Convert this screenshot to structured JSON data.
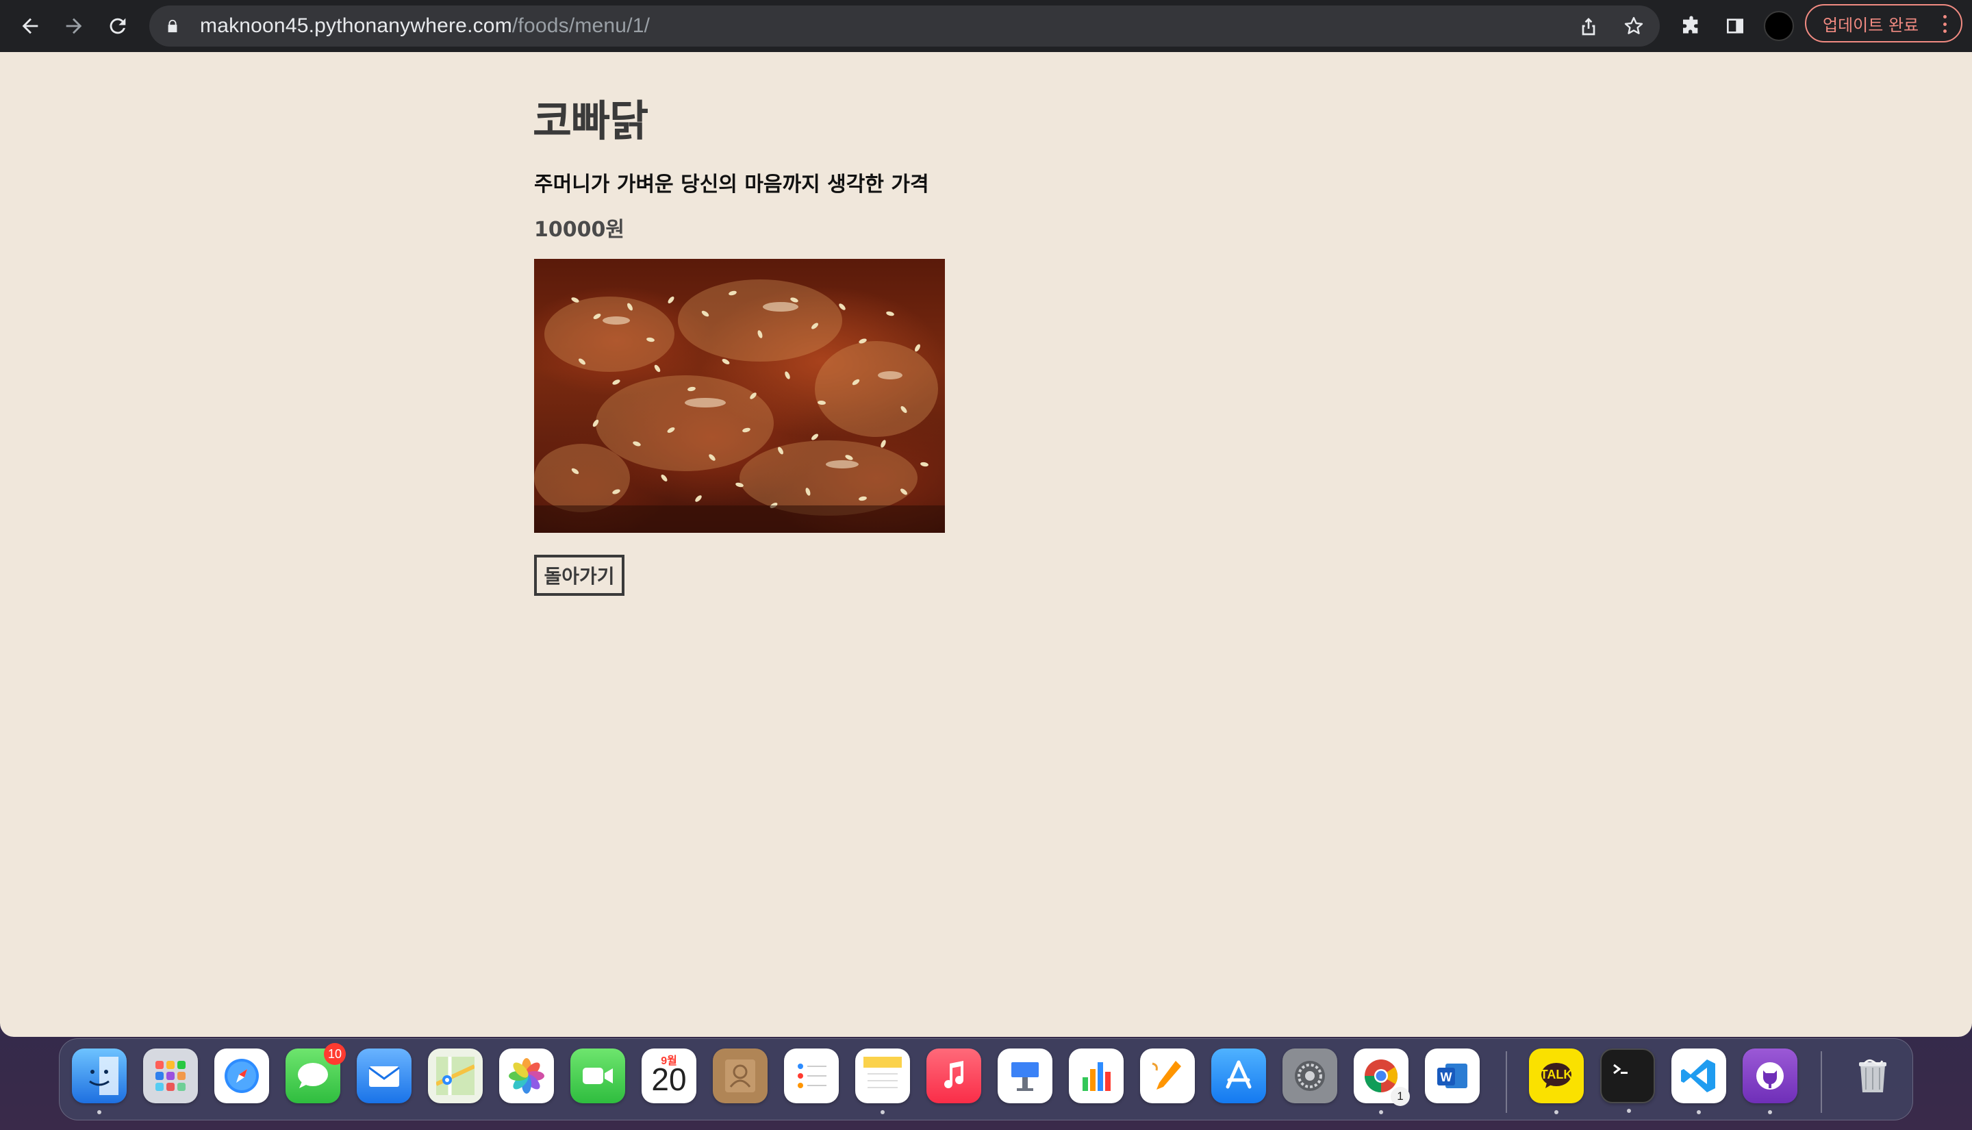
{
  "browser": {
    "url_host": "maknoon45.pythonanywhere.com",
    "url_path": "/foods/menu/1/",
    "update_label": "업데이트 완료"
  },
  "page": {
    "title": "코빠닭",
    "tagline": "주머니가 가벼운 당신의 마음까지 생각한 가격",
    "price": "10000원",
    "back_label": "돌아가기"
  },
  "dock": {
    "apps": [
      "finder",
      "launchpad",
      "safari",
      "messages",
      "mail",
      "maps",
      "photos",
      "facetime",
      "calendar",
      "contacts",
      "reminders",
      "notes",
      "music",
      "keynote",
      "numbers",
      "pages",
      "app-store",
      "system-preferences",
      "chrome",
      "word",
      "kakaotalk",
      "terminal",
      "vscode",
      "github-desktop",
      "trash"
    ],
    "messages_badge": "10",
    "calendar_month": "9월",
    "calendar_day": "20",
    "kakaotalk_label": "TALK",
    "chrome_badge": "1"
  }
}
